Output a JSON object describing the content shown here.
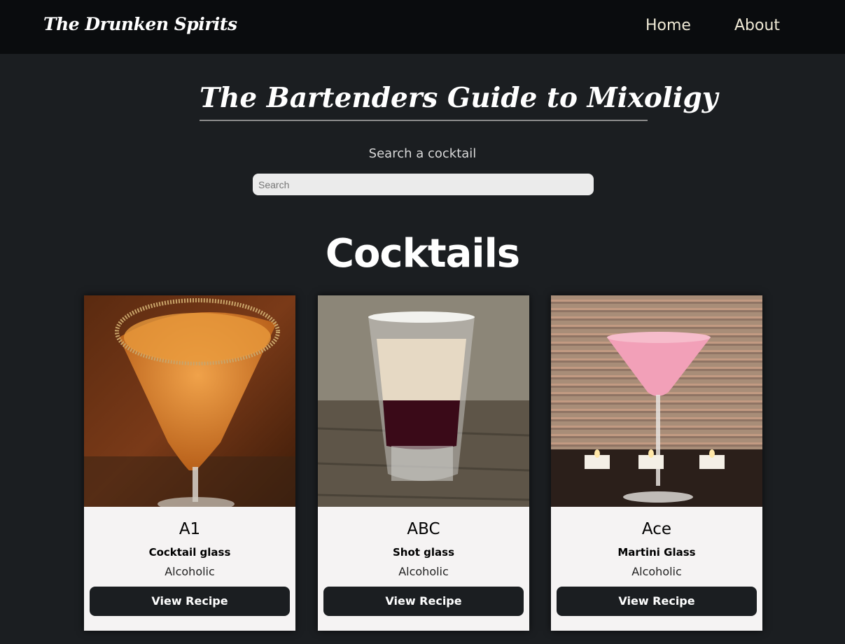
{
  "navbar": {
    "brand": "The Drunken Spirits",
    "links": [
      "Home",
      "About"
    ]
  },
  "hero": {
    "title": "The Bartenders Guide to Mixoligy",
    "search_label": "Search a cocktail",
    "search_placeholder": "Search",
    "search_value": ""
  },
  "section": {
    "title": "Cocktails"
  },
  "cocktails": [
    {
      "name": "A1",
      "glass": "Cocktail glass",
      "type": "Alcoholic",
      "button": "View Recipe",
      "image": "orange-martini-photo"
    },
    {
      "name": "ABC",
      "glass": "Shot glass",
      "type": "Alcoholic",
      "button": "View Recipe",
      "image": "layered-shot-photo"
    },
    {
      "name": "Ace",
      "glass": "Martini Glass",
      "type": "Alcoholic",
      "button": "View Recipe",
      "image": "pink-martini-photo"
    }
  ],
  "colors": {
    "background": "#1b1e21",
    "navbar": "#0a0c0e",
    "card": "#f5f3f3",
    "button": "#1b1e21"
  }
}
